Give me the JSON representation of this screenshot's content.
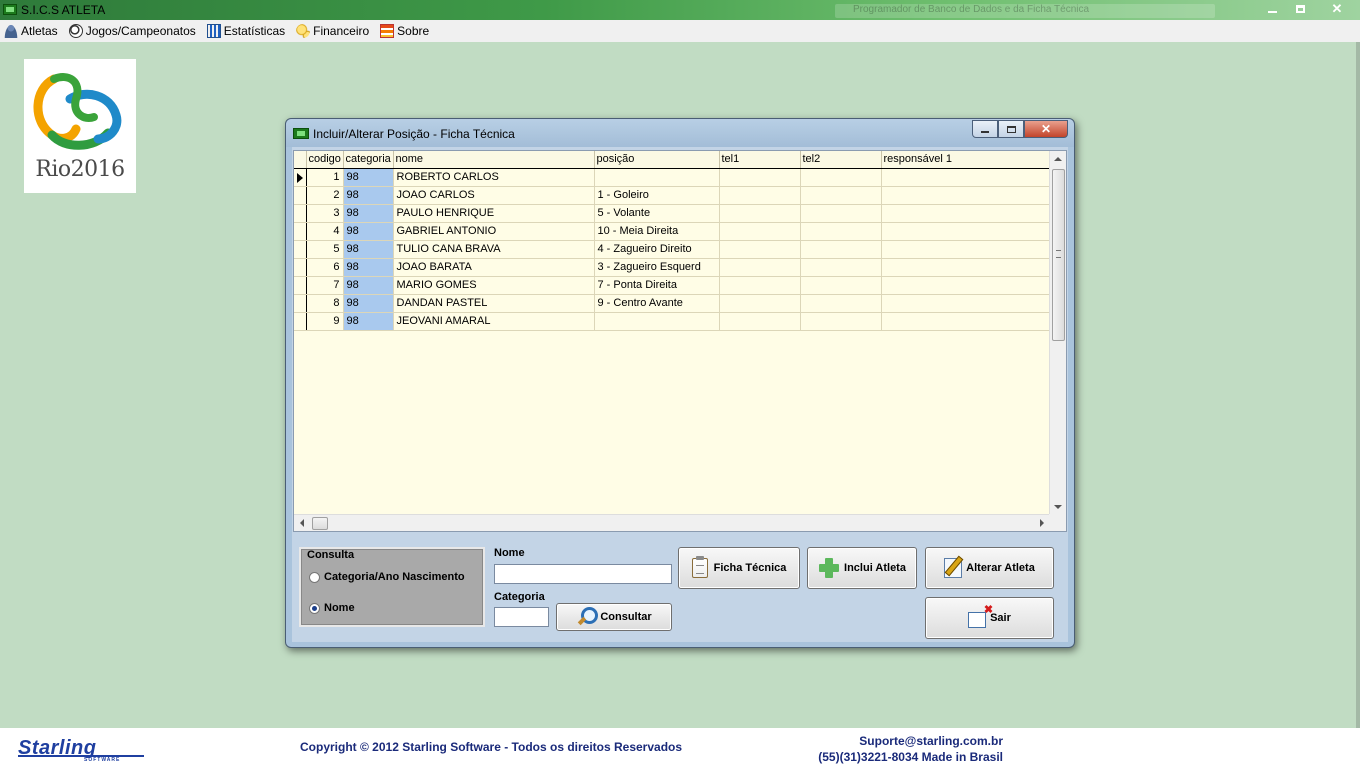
{
  "app": {
    "title": "S.I.C.S ATLETA",
    "background_title": "Programador de Banco de Dados e da Ficha Técnica"
  },
  "menu": [
    {
      "label": "Atletas",
      "icon": "person-icon"
    },
    {
      "label": "Jogos/Campeonatos",
      "icon": "soccer-ball-icon"
    },
    {
      "label": "Estatísticas",
      "icon": "chart-icon"
    },
    {
      "label": "Financeiro",
      "icon": "coins-icon"
    },
    {
      "label": "Sobre",
      "icon": "about-icon"
    }
  ],
  "logo": {
    "text": "Rio2016"
  },
  "dialog": {
    "title": "Incluir/Alterar Posição - Ficha Técnica",
    "grid": {
      "columns": [
        "codigo",
        "categoria",
        "nome",
        "posição",
        "tel1",
        "tel2",
        "responsável 1"
      ],
      "rows": [
        {
          "codigo": "1",
          "categoria": "98",
          "nome": "ROBERTO CARLOS",
          "posicao": "",
          "tel1": "",
          "tel2": "",
          "resp1": ""
        },
        {
          "codigo": "2",
          "categoria": "98",
          "nome": "JOAO CARLOS",
          "posicao": "1 - Goleiro",
          "tel1": "",
          "tel2": "",
          "resp1": ""
        },
        {
          "codigo": "3",
          "categoria": "98",
          "nome": "PAULO HENRIQUE",
          "posicao": "5 - Volante",
          "tel1": "",
          "tel2": "",
          "resp1": ""
        },
        {
          "codigo": "4",
          "categoria": "98",
          "nome": "GABRIEL ANTONIO",
          "posicao": "10 - Meia Direita",
          "tel1": "",
          "tel2": "",
          "resp1": ""
        },
        {
          "codigo": "5",
          "categoria": "98",
          "nome": "TULIO CANA BRAVA",
          "posicao": "4 - Zagueiro Direito",
          "tel1": "",
          "tel2": "",
          "resp1": ""
        },
        {
          "codigo": "6",
          "categoria": "98",
          "nome": "JOAO BARATA",
          "posicao": "3 - Zagueiro Esquerd",
          "tel1": "",
          "tel2": "",
          "resp1": ""
        },
        {
          "codigo": "7",
          "categoria": "98",
          "nome": "MARIO GOMES",
          "posicao": "7 - Ponta Direita",
          "tel1": "",
          "tel2": "",
          "resp1": ""
        },
        {
          "codigo": "8",
          "categoria": "98",
          "nome": "DANDAN PASTEL",
          "posicao": "9 - Centro Avante",
          "tel1": "",
          "tel2": "",
          "resp1": ""
        },
        {
          "codigo": "9",
          "categoria": "98",
          "nome": "JEOVANI AMARAL",
          "posicao": "",
          "tel1": "",
          "tel2": "",
          "resp1": ""
        }
      ],
      "current_row": 0
    },
    "consulta": {
      "legend": "Consulta",
      "options": [
        "Categoria/Ano Nascimento",
        "Nome"
      ],
      "selected": "Nome"
    },
    "nome_label": "Nome",
    "nome_value": "",
    "categoria_label": "Categoria",
    "categoria_value": "",
    "buttons": {
      "consultar": "Consultar",
      "ficha_tecnica": "Ficha Técnica",
      "inclui_atleta": "Inclui Atleta",
      "alterar_atleta": "Alterar Atleta",
      "sair": "Sair"
    }
  },
  "footer": {
    "brand": "Starling",
    "brand_sub": "SOFTWARE",
    "copyright": "Copyright © 2012 Starling Software - Todos os direitos Reservados",
    "support": "Suporte@starling.com.br",
    "phone": "(55)(31)3221-8034 Made in Brasil"
  },
  "colors": {
    "desktop": "#c1dcc3",
    "grid_background": "#fffde6",
    "category_highlight": "#a9c9ee",
    "footer_text": "#1a2a7a"
  }
}
